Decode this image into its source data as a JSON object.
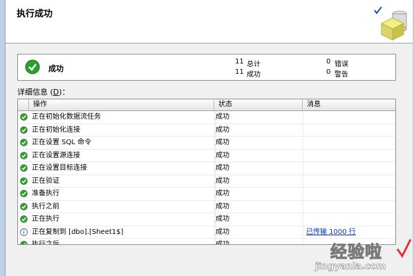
{
  "header": {
    "title": "执行成功"
  },
  "summary": {
    "status": "成功",
    "total_count": "11",
    "total_label": "总计",
    "success_count": "11",
    "success_label": "成功",
    "error_count": "0",
    "error_label": "错误",
    "warning_count": "0",
    "warning_label": "警告"
  },
  "details": {
    "label_prefix": "详细信息 (",
    "label_key": "D",
    "label_suffix": ")："
  },
  "grid": {
    "columns": [
      "操作",
      "状态",
      "消息"
    ],
    "rows": [
      {
        "icon": "success-icon",
        "operation": "正在初始化数据流任务",
        "status": "成功",
        "message": ""
      },
      {
        "icon": "success-icon",
        "operation": "正在初始化连接",
        "status": "成功",
        "message": ""
      },
      {
        "icon": "success-icon",
        "operation": "正在设置 SQL 命令",
        "status": "成功",
        "message": ""
      },
      {
        "icon": "success-icon",
        "operation": "正在设置源连接",
        "status": "成功",
        "message": ""
      },
      {
        "icon": "success-icon",
        "operation": "正在设置目标连接",
        "status": "成功",
        "message": ""
      },
      {
        "icon": "success-icon",
        "operation": "正在验证",
        "status": "成功",
        "message": ""
      },
      {
        "icon": "success-icon",
        "operation": "准备执行",
        "status": "成功",
        "message": ""
      },
      {
        "icon": "success-icon",
        "operation": "执行之前",
        "status": "成功",
        "message": ""
      },
      {
        "icon": "success-icon",
        "operation": "正在执行",
        "status": "成功",
        "message": ""
      },
      {
        "icon": "info-icon",
        "operation": "正在复制到 [dbo].[Sheet1$]",
        "status": "成功",
        "message": "已传输 1000 行"
      },
      {
        "icon": "success-icon",
        "operation": "执行之后",
        "status": "成功",
        "message": ""
      }
    ]
  },
  "watermark": {
    "main": "经验啦",
    "sub": "jingyanla.com"
  },
  "colors": {
    "success_green": "#2e9e2e",
    "link_blue": "#0033cc",
    "frame_blue": "#bcd1e6"
  }
}
